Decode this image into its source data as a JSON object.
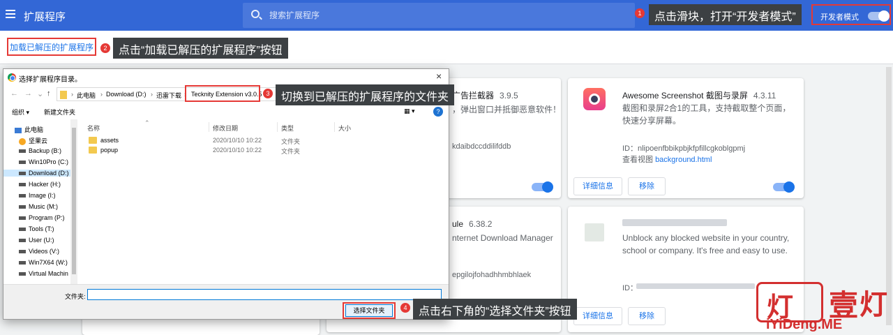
{
  "header": {
    "title": "扩展程序",
    "search_placeholder": "搜索扩展程序",
    "devmode_label": "开发者模式"
  },
  "subbar": {
    "load_unpacked_label": "加载已解压的扩展程序"
  },
  "annotations": [
    {
      "num": "1",
      "text": "点击滑块，打开“开发者模式”"
    },
    {
      "num": "2",
      "text": "点击“加载已解压的扩展程序”按钮"
    },
    {
      "num": "3",
      "text": "切换到已解压的扩展程序的文件夹"
    },
    {
      "num": "4",
      "text": "点击右下角的“选择文件夹”按钮"
    }
  ],
  "cards": {
    "card1": {
      "name_partial": "广告拦截器",
      "version": "3.9.5",
      "desc": "，弹出窗口并抵御恶意软件！",
      "id_partial": "kdaibdccddilifddb"
    },
    "awesome": {
      "name": "Awesome Screenshot 截图与录屏",
      "version": "4.3.11",
      "desc": "截图和录屏2合1的工具，支持截取整个页面，快速分享屏幕。",
      "id": "ID：nlipoenfbbikpbjkfpfillcgkoblgpmj",
      "inspect_label": "查看视图",
      "inspect_link": "background.html",
      "details_btn": "详细信息",
      "remove_btn": "移除"
    },
    "idm": {
      "name_partial": "ule",
      "version": "6.38.2",
      "desc": "nternet Download Manager",
      "id_partial": "epgilojfohadhhmbhlaek"
    },
    "vpn": {
      "desc": "Unblock any blocked website in your country, school or company. It's free and easy to use.",
      "id_label": "ID：",
      "details_btn": "详细信息",
      "remove_btn": "移除"
    }
  },
  "dialog": {
    "title": "选择扩展程序目录。",
    "close": "×",
    "breadcrumb": [
      "此电脑",
      "Download (D:)",
      "迅雷下载",
      "Tecknity Extension v3.0.5"
    ],
    "toolbar": {
      "organize": "组织 ▾",
      "new_folder": "新建文件夹",
      "view": "▦ ▾",
      "help": "?"
    },
    "nav": [
      "此电脑",
      "坚果云",
      "Backup (B:)",
      "Win10Pro (C:)",
      "Download (D:)",
      "Hacker (H:)",
      "Image (I:)",
      "Music (M:)",
      "Program (P:)",
      "Tools (T:)",
      "User (U:)",
      "Videos (V:)",
      "Win7X64 (W:)",
      "Virtual Machin"
    ],
    "columns": {
      "name": "名称",
      "date": "修改日期",
      "type": "类型",
      "size": "大小"
    },
    "files": [
      {
        "name": "assets",
        "date": "2020/10/10 10:22",
        "type": "文件夹"
      },
      {
        "name": "popup",
        "date": "2020/10/10 10:22",
        "type": "文件夹"
      }
    ],
    "folder_label": "文件夹:",
    "select_btn": "选择文件夹"
  },
  "watermark": {
    "chars": [
      "灯",
      "壹",
      "灯"
    ],
    "sub": "iYiDeng.ME"
  },
  "colors": {
    "topbar": "#3367d6",
    "accent": "#1a73e8",
    "annotation_red": "#e53935"
  }
}
